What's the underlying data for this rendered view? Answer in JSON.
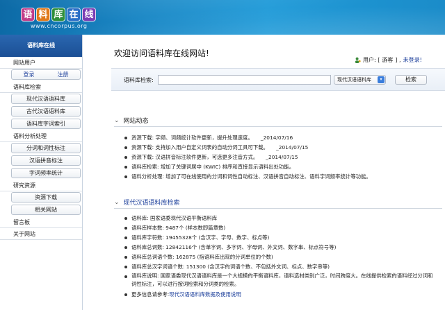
{
  "header": {
    "logo_chars": [
      "语",
      "料",
      "库",
      "在",
      "线"
    ],
    "logo_colors": [
      "#c13c8a",
      "#e07a1b",
      "#2f8f3a",
      "#2b6fc7",
      "#7a3db3"
    ],
    "logo_url": "www.cncorpus.org"
  },
  "sidebar": {
    "title": "语料库在线",
    "groups": [
      {
        "label": "网站用户",
        "login": "登录",
        "register": "注册"
      },
      {
        "label": "语料库检索",
        "items": [
          "现代汉语语料库",
          "古代汉语语料库",
          "语料库字词索引"
        ]
      },
      {
        "label": "语料分析处理",
        "items": [
          "分词和词性标注",
          "汉语拼音标注",
          "字词频率统计"
        ]
      },
      {
        "label": "研究资源",
        "items": [
          "资源下载",
          "相关网站"
        ]
      },
      {
        "label": "留言板"
      },
      {
        "label": "关于网站"
      }
    ]
  },
  "main": {
    "welcome": "欢迎访问语料库在线网站!",
    "user_prefix": "用户: [",
    "user_name": "游客",
    "user_suffix": "] ,",
    "user_login": "未登录!",
    "search": {
      "label": "语料库检索:",
      "value": "",
      "corpus": "现代汉语语料库",
      "button": "检索"
    },
    "news": {
      "title": "网站动态",
      "items": [
        "资源下载: 字频、词频统计软件更新，提升处理速度。　　_2014/07/16",
        "资源下载: 支持加入用户自定义词表的自动分词工具可下载。　　_2014/07/15",
        "资源下载: 汉语拼音标注软件更新，可选更多注音方式。　　_2014/07/15",
        "语料库检索: 增加了关键词居中 (KWIC) 排序和直接显示语料出处功能。",
        "语料分析处理: 增加了可在线使用的分词和词性自动标注、汉语拼音自动标注、语料字词频率统计等功能。"
      ]
    },
    "corpus": {
      "title": "现代汉语语料库检索",
      "items": [
        "语料库: 国家语委现代汉语平衡语料库",
        "语料库样本数: 9487个 (样本数即篇章数)",
        "语料库字符数: 19455328个 (含汉字、字母、数字、标点等)",
        "语料库总词数: 12842116个 (含单字词、多字词、字母词、外文词、数字串、标点符号等)",
        "语料库总词语个数: 162875 (指语料库出现的分词单位的个数)",
        "语料库总汉字词语个数: 151300 (含汉字的词语个数、不包括外文词、标点、数字串等)",
        "语料库说明: 国家语委现代汉语语料库是一个大规模的平衡语料库，语料选材类别广泛，时间跨度大。在线提供检索的语料经过分词和词性标注，可以进行按词检索和分词类的检索。"
      ],
      "more_prefix": "更多信息请参考:",
      "more_link": "现代汉语语料库数据及使用说明"
    }
  }
}
